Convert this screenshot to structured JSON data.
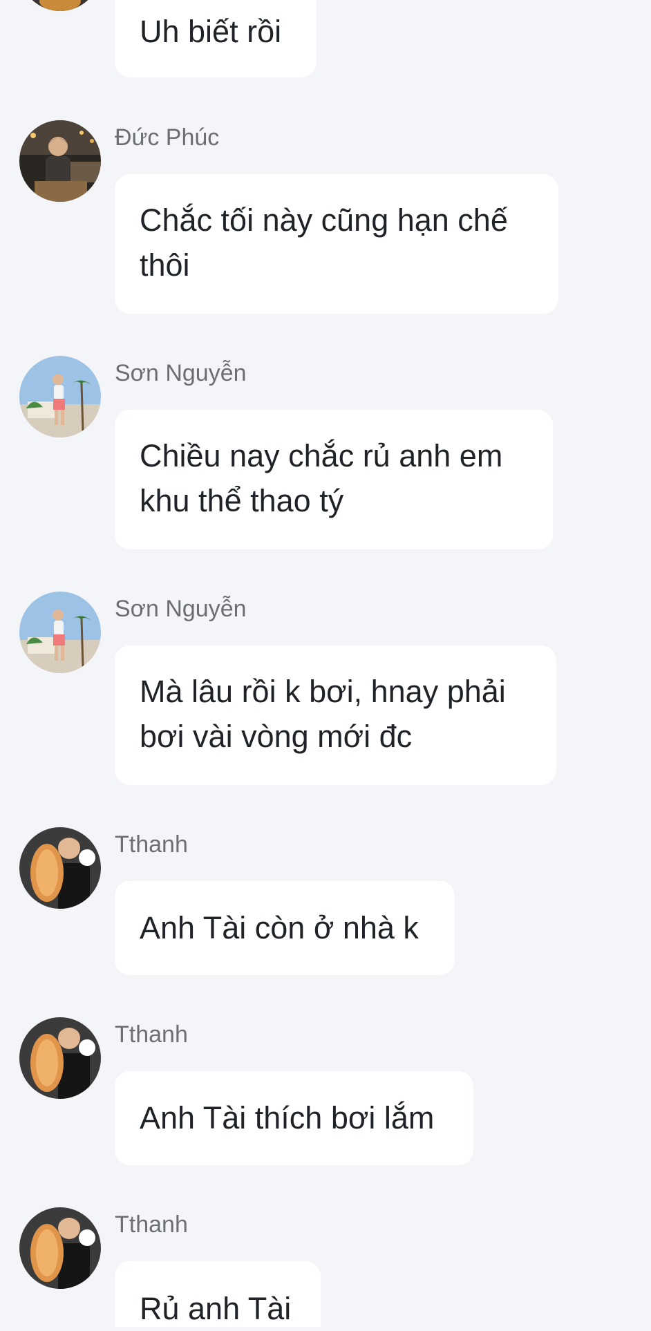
{
  "messages": [
    {
      "sender": "",
      "text": "Uh biết rồi",
      "avatar": "avatar-photo-partial"
    },
    {
      "sender": "Đức Phúc",
      "text": "Chắc tối này cũng hạn chế thôi",
      "avatar": "avatar-photo-night-city"
    },
    {
      "sender": "Sơn Nguyễn",
      "text": "Chiều nay chắc rủ anh em khu thể thao tý",
      "avatar": "avatar-photo-palm-trees"
    },
    {
      "sender": "Sơn Nguyễn",
      "text": "Mà lâu rồi k bơi, hnay phải bơi vài vòng mới đc",
      "avatar": "avatar-photo-palm-trees"
    },
    {
      "sender": "Tthanh",
      "text": "Anh Tài còn ở nhà k",
      "avatar": "avatar-photo-bread"
    },
    {
      "sender": "Tthanh",
      "text": "Anh Tài thích bơi lắm",
      "avatar": "avatar-photo-bread"
    },
    {
      "sender": "Tthanh",
      "text": "Rủ anh Tài",
      "avatar": "avatar-photo-bread"
    }
  ]
}
